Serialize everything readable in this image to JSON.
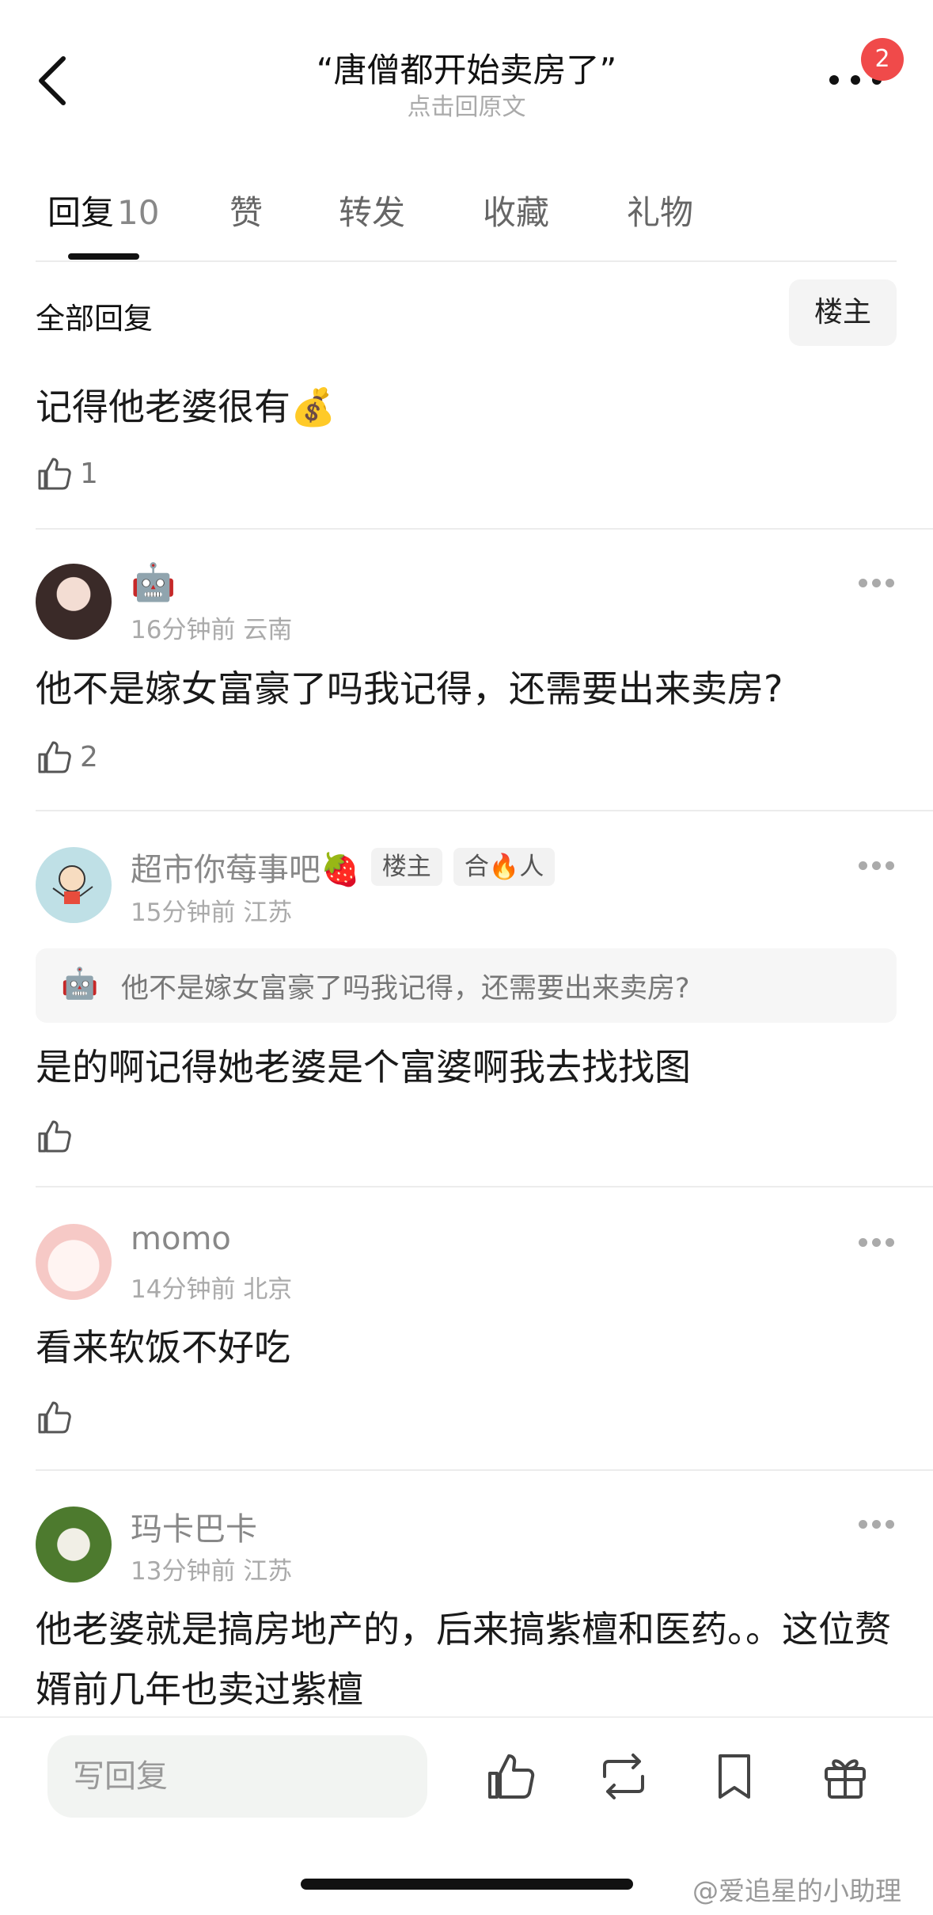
{
  "header": {
    "title": "“唐僧都开始卖房了”",
    "subtitle": "点击回原文",
    "badge_count": "2"
  },
  "tabs": [
    {
      "label": "回复",
      "count": "10",
      "active": true
    },
    {
      "label": "赞"
    },
    {
      "label": "转发"
    },
    {
      "label": "收藏"
    },
    {
      "label": "礼物"
    }
  ],
  "filter": {
    "label": "全部回复",
    "owner_button": "楼主"
  },
  "comments": [
    {
      "text": "记得他老婆很有💰",
      "likes": "1"
    },
    {
      "username": "🤖",
      "time": "16分钟前",
      "location": "云南",
      "text": "他不是嫁女富豪了吗我记得，还需要出来卖房?",
      "likes": "2"
    },
    {
      "username": "超市你莓事吧🍓",
      "tags": [
        "楼主",
        "合🔥人"
      ],
      "time": "15分钟前",
      "location": "江苏",
      "quote_icon": "🤖",
      "quote": "他不是嫁女富豪了吗我记得，还需要出来卖房?",
      "text": "是的啊记得她老婆是个富婆啊我去找找图",
      "likes": ""
    },
    {
      "username": "momo",
      "time": "14分钟前",
      "location": "北京",
      "text": "看来软饭不好吃",
      "likes": ""
    },
    {
      "username": "玛卡巴卡",
      "time": "13分钟前",
      "location": "江苏",
      "text": "他老婆就是搞房地产的，后来搞紫檀和医药。。这位赘婿前几年也卖过紫檀"
    }
  ],
  "bottom_bar": {
    "reply_placeholder": "写回复",
    "icons": [
      "like-icon",
      "repost-icon",
      "bookmark-icon",
      "gift-icon"
    ]
  },
  "watermark": "@爱追星的小助理"
}
